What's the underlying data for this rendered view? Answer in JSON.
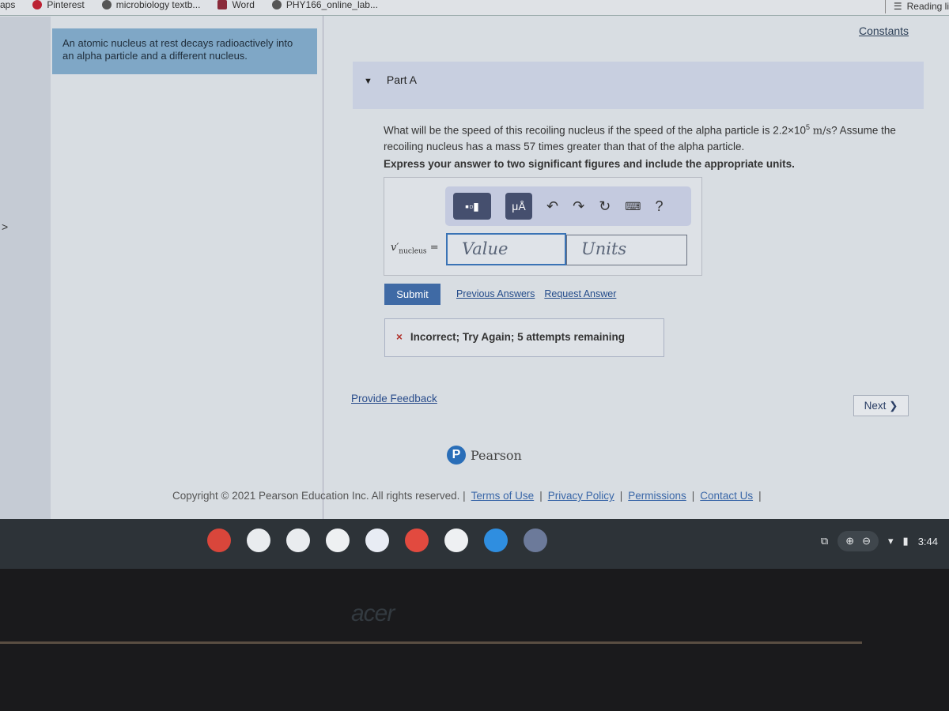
{
  "bookmarks": [
    {
      "label": "aps"
    },
    {
      "label": "Pinterest"
    },
    {
      "label": "microbiology textb..."
    },
    {
      "label": "Word"
    },
    {
      "label": "PHY166_online_lab..."
    }
  ],
  "reading_list": "Reading li",
  "intro": "An atomic nucleus at rest decays radioactively into an alpha particle and a different nucleus.",
  "constants": "Constants",
  "part": {
    "label": "Part A"
  },
  "question": {
    "text1": "What will be the speed of this recoiling nucleus if the speed of the alpha particle is ",
    "speed_mantissa": "2.2×10",
    "speed_exp": "5",
    "unit": "m/s",
    "text2": "? Assume the recoiling nucleus has a mass 57 times greater than that of the alpha particle."
  },
  "instructions": "Express your answer to two significant figures and include the appropriate units.",
  "toolbar": {
    "units_btn": "μÅ",
    "help": "?"
  },
  "answer": {
    "label_var": "v′",
    "label_sub": "nucleus",
    "equals": "=",
    "value_placeholder": "Value",
    "units_placeholder": "Units"
  },
  "submit": "Submit",
  "previous_answers": "Previous Answers",
  "request_answer": "Request Answer",
  "feedback": {
    "icon": "×",
    "text": "Incorrect; Try Again; 5 attempts remaining"
  },
  "provide_feedback": "Provide Feedback",
  "next": "Next ❯",
  "pearson": "Pearson",
  "footer": {
    "copyright": "Copyright © 2021 Pearson Education Inc. All rights reserved. |",
    "links": [
      "Terms of Use",
      "Privacy Policy",
      "Permissions",
      "Contact Us"
    ]
  },
  "shelf": {
    "apps": [
      {
        "name": "chrome",
        "color": "#d9463b"
      },
      {
        "name": "meet",
        "color": "#e9ecef"
      },
      {
        "name": "photos",
        "color": "#e9ecef"
      },
      {
        "name": "gmail",
        "color": "#eef0f2"
      },
      {
        "name": "docs",
        "color": "#e8ecf4"
      },
      {
        "name": "youtube",
        "color": "#e24a3f"
      },
      {
        "name": "play-store",
        "color": "#eef0f2"
      },
      {
        "name": "files",
        "color": "#2f8ee0"
      },
      {
        "name": "settings",
        "color": "#6c7a9a"
      }
    ],
    "time": "3:44"
  },
  "brand": "acer"
}
